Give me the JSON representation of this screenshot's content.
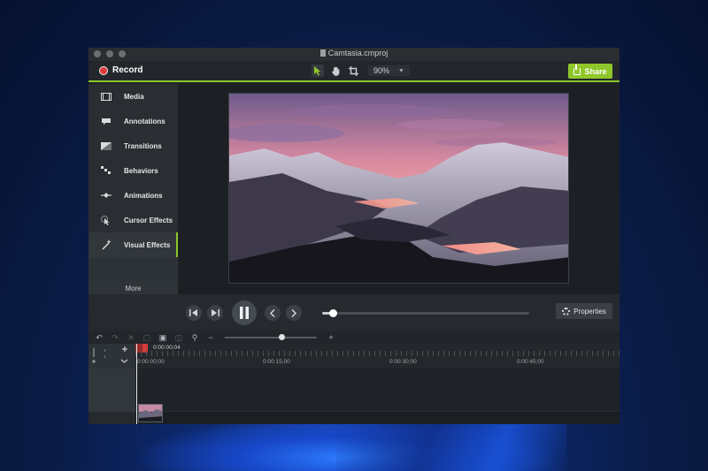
{
  "window": {
    "title": "Camtasia.cmproj"
  },
  "toolbar": {
    "record_label": "Record",
    "zoom_value": "90%",
    "share_label": "Share",
    "tools": [
      "select-arrow-icon",
      "hand-pan-icon",
      "crop-icon"
    ]
  },
  "sidebar": {
    "items": [
      {
        "label": "Media",
        "icon": "film-icon"
      },
      {
        "label": "Annotations",
        "icon": "annotation-icon"
      },
      {
        "label": "Transitions",
        "icon": "transition-icon"
      },
      {
        "label": "Behaviors",
        "icon": "behaviors-icon"
      },
      {
        "label": "Animations",
        "icon": "animation-icon"
      },
      {
        "label": "Cursor Effects",
        "icon": "cursor-effects-icon"
      },
      {
        "label": "Visual Effects",
        "icon": "magic-wand-icon"
      }
    ],
    "selected": "Visual Effects",
    "more_label": "More"
  },
  "player": {
    "properties_label": "Properties",
    "scrub_progress": 0.05
  },
  "timeline": {
    "playhead_time": "0:00:00;04",
    "ruler_labels": [
      "0:00:00;00",
      "0:00:15;00",
      "0:00:30;00",
      "0:00:45;00"
    ],
    "zoom_level": 0.62
  },
  "colors": {
    "accent": "#8fc62a",
    "record": "#e03a3a",
    "window_bg": "#1e2226"
  }
}
